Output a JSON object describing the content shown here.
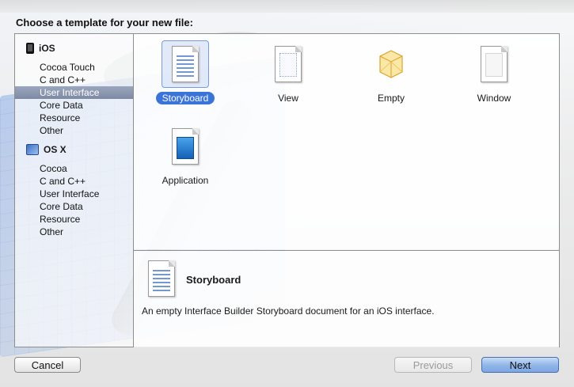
{
  "dialog": {
    "title": "Choose a template for your new file:"
  },
  "sidebar": {
    "groups": [
      {
        "name": "iOS",
        "icon": "iphone-icon",
        "items": [
          "Cocoa Touch",
          "C and C++",
          "User Interface",
          "Core Data",
          "Resource",
          "Other"
        ]
      },
      {
        "name": "OS X",
        "icon": "mac-icon",
        "items": [
          "Cocoa",
          "C and C++",
          "User Interface",
          "Core Data",
          "Resource",
          "Other"
        ]
      }
    ],
    "selected": "User Interface"
  },
  "templates": [
    {
      "label": "Storyboard",
      "icon": "storyboard-icon",
      "selected": true
    },
    {
      "label": "View",
      "icon": "view-icon",
      "selected": false
    },
    {
      "label": "Empty",
      "icon": "empty-icon",
      "selected": false
    },
    {
      "label": "Window",
      "icon": "window-icon",
      "selected": false
    },
    {
      "label": "Application",
      "icon": "application-icon",
      "selected": false
    }
  ],
  "detail": {
    "name": "Storyboard",
    "description": "An empty Interface Builder Storyboard document for an iOS interface."
  },
  "buttons": {
    "cancel": "Cancel",
    "previous": "Previous",
    "next": "Next"
  },
  "colors": {
    "selection": "#3a74d8",
    "sidebar_selection": "#8a96ad"
  }
}
